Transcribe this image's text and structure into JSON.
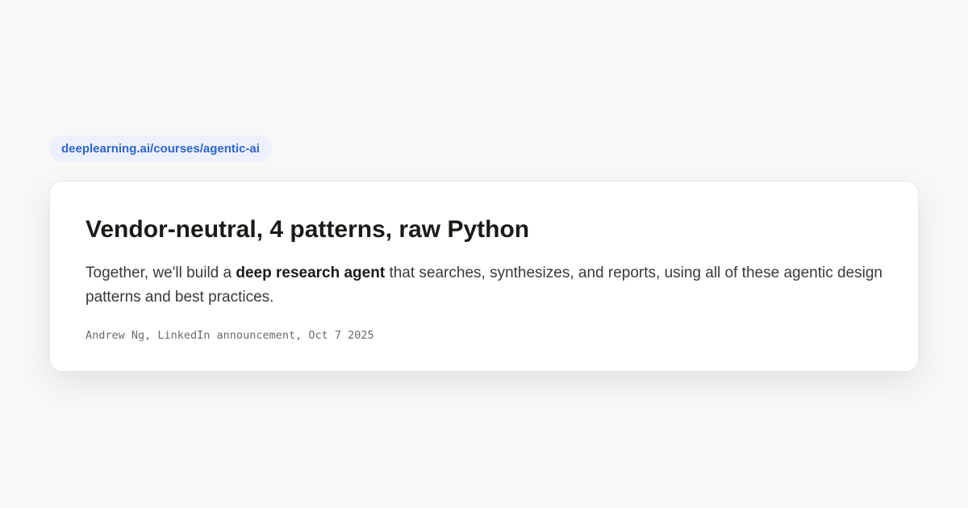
{
  "source_link": {
    "label": "deeplearning.ai/courses/agentic-ai"
  },
  "quote_card": {
    "headline": "Vendor-neutral, 4 patterns, raw Python",
    "body": {
      "before": "Together, we'll build a ",
      "emphasis": "deep research agent",
      "after": " that searches, synthesizes, and reports, using all of these agentic design patterns and best practices."
    },
    "attribution": "Andrew Ng, LinkedIn announcement, Oct 7 2025"
  },
  "colors": {
    "page_background": "#f9f8f6",
    "link_accent": "#2f66cc",
    "link_pill_background": "#ecf1fb",
    "card_background": "#ffffff",
    "headline_text": "#1c1a17",
    "body_text": "#3b3935",
    "attribution_text": "#6e6b66"
  }
}
